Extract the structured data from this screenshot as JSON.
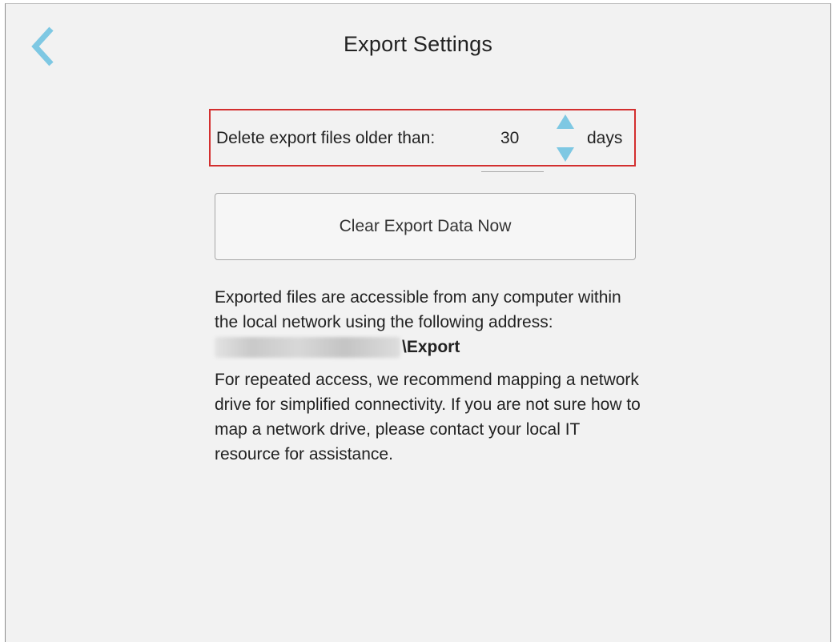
{
  "header": {
    "title": "Export Settings",
    "back_icon": "chevron-left-icon",
    "accent_color": "#7ec8e3"
  },
  "retention": {
    "label": "Delete export files older than:",
    "value": "30",
    "unit": "days",
    "up_icon": "triangle-up-icon",
    "down_icon": "triangle-down-icon",
    "highlight_color": "#d32f2f"
  },
  "actions": {
    "clear_label": "Clear Export Data Now"
  },
  "info": {
    "paragraph1": "Exported files are accessible from any computer within the local network using the following address:",
    "address_suffix": "\\Export",
    "paragraph2": "For repeated access, we recommend mapping a network drive for simplified connectivity. If you are not sure how to map a network drive, please contact your local IT resource for assistance."
  }
}
